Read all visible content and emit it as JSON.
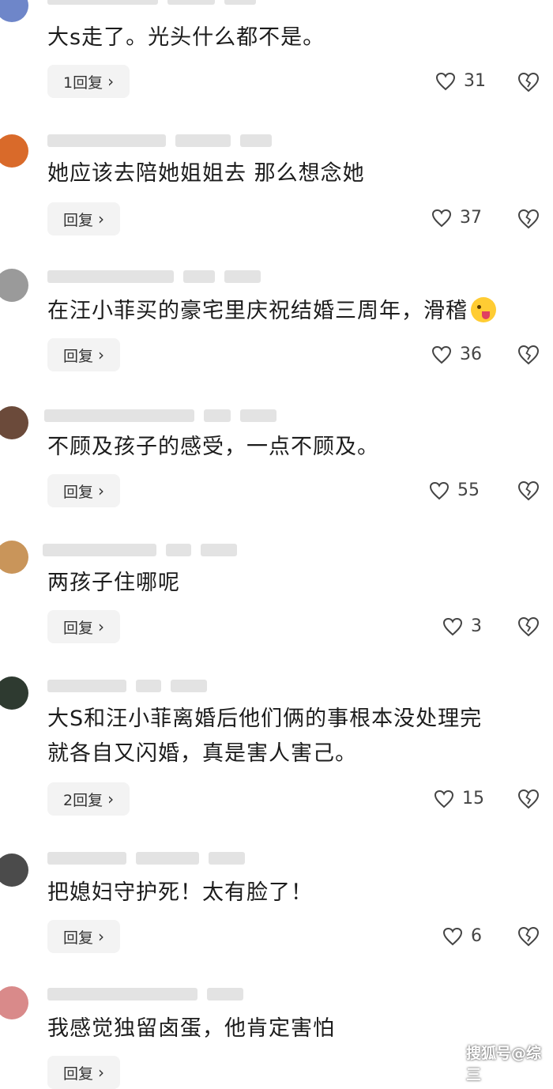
{
  "comments": [
    {
      "text": "大s走了。光头什么都不是。",
      "reply": "1回复",
      "likes": "31"
    },
    {
      "text": "她应该去陪她姐姐去 那么想念她",
      "reply": "回复",
      "likes": "37"
    },
    {
      "text": "在汪小菲买的豪宅里庆祝结婚三周年，滑稽",
      "reply": "回复",
      "likes": "36"
    },
    {
      "text": "不顾及孩子的感受，一点不顾及。",
      "reply": "回复",
      "likes": "55"
    },
    {
      "text": "两孩子住哪呢",
      "reply": "回复",
      "likes": "3"
    },
    {
      "text": "大S和汪小菲离婚后他们俩的事根本没处理完\n就各自又闪婚，真是害人害己。",
      "reply": "2回复",
      "likes": "15"
    },
    {
      "text": "把媳妇守护死！太有脸了！",
      "reply": "回复",
      "likes": "6"
    },
    {
      "text": "我感觉独留卤蛋，他肯定害怕",
      "reply": "回复",
      "likes": ""
    }
  ],
  "chevron": "›",
  "watermark": "搜狐号@综三",
  "colors": {
    "accent_bg": "#f3f3f3",
    "text": "#1c1c1c"
  },
  "icons": {
    "like": "heart-outline-icon",
    "dislike": "broken-heart-icon"
  }
}
